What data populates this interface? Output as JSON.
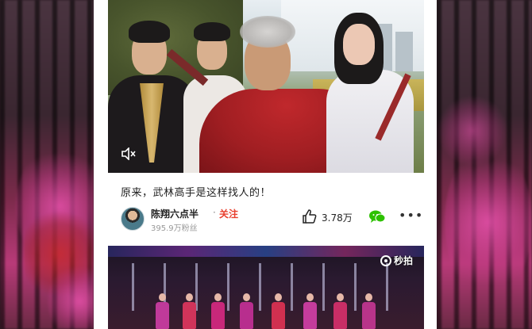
{
  "feed": {
    "post": {
      "caption": "原来，武林高手是这样找人的！",
      "author_name": "陈翔六点半",
      "separator": "·",
      "follow_label": "关注",
      "fans_count": "395.9万粉丝",
      "like_count": "3.78万",
      "more_label": "•••"
    },
    "next_video": {
      "watermark": "秒拍"
    }
  },
  "icons": {
    "mute": "speaker-mute-icon",
    "like": "thumbs-up-icon",
    "share": "wechat-icon",
    "more": "more-dots-icon"
  },
  "colors": {
    "follow": "#e8402f",
    "wechat": "#2dc100"
  }
}
